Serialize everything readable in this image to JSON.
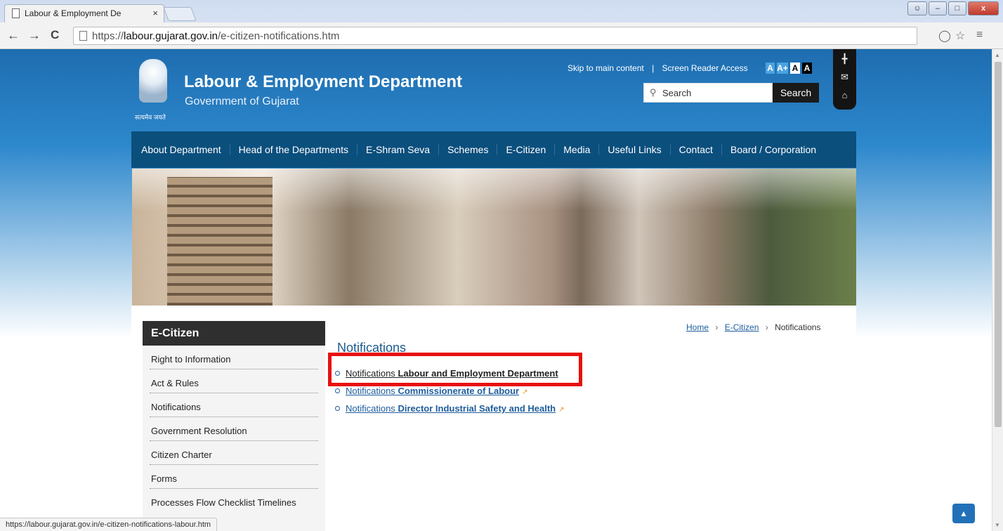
{
  "browser": {
    "tab_title": "Labour & Employment De",
    "tab_close": "×",
    "url_prefix": "https://",
    "url_host": "labour.gujarat.gov.in",
    "url_path": "/e-citizen-notifications.htm",
    "back_icon": "←",
    "forward_icon": "→",
    "reload_icon": "C",
    "status_url": "https://labour.gujarat.gov.in/e-citizen-notifications-labour.htm"
  },
  "header": {
    "title": "Labour & Employment Department",
    "subtitle": "Government of Gujarat",
    "emblem_motto": "सत्यमेव जयते",
    "skip_link": "Skip to main content",
    "sep": "|",
    "screen_reader": "Screen Reader Access",
    "font_a": "A",
    "font_a_plus": "A+",
    "font_a_white": "A",
    "font_a_black": "A",
    "search_placeholder": "Search",
    "search_button": "Search"
  },
  "nav": {
    "items": [
      "About Department",
      "Head of the Departments",
      "E-Shram Seva",
      "Schemes",
      "E-Citizen",
      "Media",
      "Useful Links",
      "Contact",
      "Board / Corporation"
    ]
  },
  "sidebar": {
    "heading": "E-Citizen",
    "items": [
      "Right to Information",
      "Act & Rules",
      "Notifications",
      "Government Resolution",
      "Citizen Charter",
      "Forms",
      "Processes Flow Checklist Timelines"
    ]
  },
  "breadcrumb": {
    "home": "Home",
    "section": "E-Citizen",
    "current": "Notifications",
    "sep": "›"
  },
  "main": {
    "heading": "Notifications",
    "links": [
      {
        "prefix": "Notifications",
        "bold": "Labour and Employment Department"
      },
      {
        "prefix": "Notifications",
        "bold": "Commissionerate of Labour"
      },
      {
        "prefix": "Notifications",
        "bold": "Director Industrial Safety and Health"
      }
    ]
  },
  "colors": {
    "nav_bg": "#0b4f7d",
    "sidebar_head_bg": "#2f2f2f",
    "link": "#1e5d9c",
    "highlight_border": "#e8100f"
  }
}
